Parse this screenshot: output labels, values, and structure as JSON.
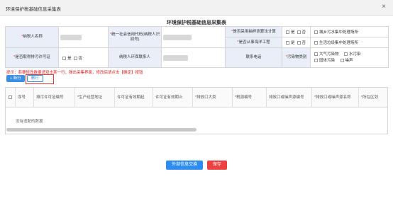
{
  "window": {
    "title": "环境保护税基础信息采集表",
    "close_glyph": "×"
  },
  "form_title": "环境保护税基础信息采集表",
  "fields": {
    "taxpayer_name": {
      "label": "纳税人名称",
      "required": "*"
    },
    "credit_code": {
      "label": "统一社会信用代码(纳税人识别号)",
      "required": "*"
    },
    "sampling_calc": {
      "label": "是否采用抽样测算法计算",
      "required": "*",
      "yes": "是",
      "no": "否"
    },
    "urban_sewage": {
      "label": "城乡污水集中处理场所"
    },
    "offshore": {
      "label": "是否从事海洋工程",
      "required": "*",
      "yes": "是",
      "no": "否"
    },
    "domestic_waste": {
      "label": "生活垃圾集中处理场所"
    },
    "emission_permit": {
      "label": "是否取得排污许可证",
      "required": "*",
      "yes": "是",
      "no": "否"
    },
    "contact": {
      "label": "纳税人环保联系人"
    },
    "phone": {
      "label": "联系电话"
    },
    "pollutant_category": {
      "label": "污染物类别",
      "required": "*",
      "options": [
        "大气污染物",
        "水污染",
        "固体污染",
        "噪声"
      ]
    }
  },
  "notice": "提示：若要修改数据请双击某一行，弹出采集界面，修改后请点击【确定】按钮",
  "toolbar": {
    "add_label": "+ 新行",
    "delete_label": "删行"
  },
  "grid": {
    "columns": [
      "序号",
      "排污许可证编号",
      "*生产经营地址",
      "许可证有效期起",
      "许可证有效期止",
      "*排放口大类",
      "*税源编号",
      "排放口或噪声源编号",
      "*排放口或噪声源名称",
      "*所在区划"
    ],
    "empty_text": "没有适配的数据"
  },
  "footer": {
    "exchange_label": "外部信息交换",
    "save_label": "保存"
  }
}
